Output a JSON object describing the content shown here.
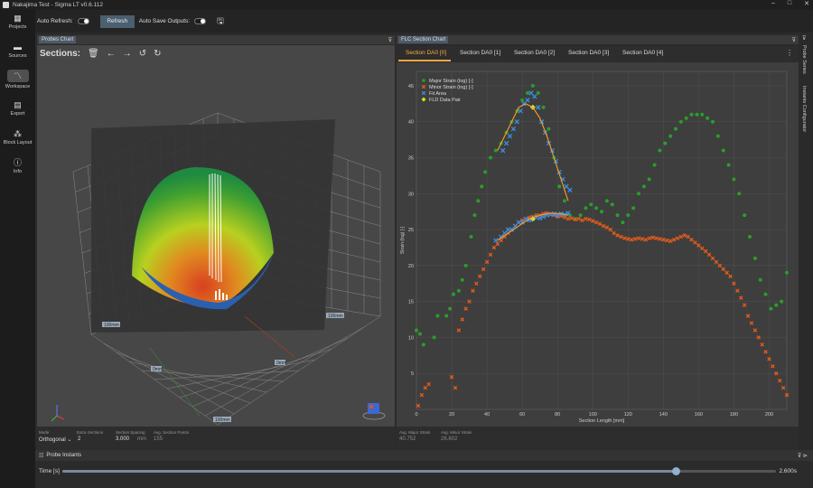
{
  "window": {
    "title": "Nakajima Test - Sigma LT v0.6.112",
    "minimize": "–",
    "maximize": "□",
    "close": "✕"
  },
  "nav": [
    {
      "label": "Projects",
      "icon": "projects-icon"
    },
    {
      "label": "Sources",
      "icon": "folder-icon"
    },
    {
      "label": "Workspace",
      "icon": "workspace-icon"
    },
    {
      "label": "Export",
      "icon": "export-icon"
    },
    {
      "label": "Block Layout",
      "icon": "block-layout-icon"
    },
    {
      "label": "Info",
      "icon": "info-icon"
    }
  ],
  "toolbar": {
    "auto_refresh": "Auto Refresh:",
    "refresh": "Refresh",
    "auto_save": "Auto Save Outputs:"
  },
  "probes_panel": {
    "title": "Probes Chart",
    "sections_label": "Sections:",
    "axis_labels": {
      "a": "100mm",
      "b": "100mm",
      "c": "0mm",
      "d": "0mm",
      "e": "100mm"
    }
  },
  "fields": {
    "mode_label": "Mode",
    "mode_value": "Orthogonal",
    "extra_label": "Extra Sections",
    "extra_value": "2",
    "spacing_label": "Section Spacing",
    "spacing_value": "3.000",
    "spacing_unit": "mm",
    "avgpts_label": "Avg. Section Points",
    "avgpts_value": "155",
    "avgmajor_label": "Avg. Major Strain",
    "avgmajor_value": "40.752",
    "avgminor_label": "Avg. Minor Strain",
    "avgminor_value": "26.602"
  },
  "flc_panel": {
    "title": "FLC Section Chart",
    "tabs": [
      "Section DA0 [0]",
      "Section DA0 [1]",
      "Section DA0 [2]",
      "Section DA0 [3]",
      "Section DA0 [4]"
    ],
    "side_tabs": [
      "Probe Series",
      "Instants Configurator"
    ]
  },
  "instants": {
    "title": "Probe Instants",
    "time_label": "Time [s]",
    "time_value": "2.600s",
    "progress": 0.86
  },
  "colors": {
    "major": "#2a9d2a",
    "minor": "#e65c1a",
    "fit": "#3a8fe8",
    "fld": "#d9e021",
    "curve": "#ffa020"
  },
  "chart_data": {
    "type": "scatter",
    "xlabel": "Section Length [mm]",
    "ylabel": "Strain (log) [-]",
    "xlim": [
      0,
      210
    ],
    "ylim": [
      0,
      47
    ],
    "xticks": [
      0,
      20,
      40,
      60,
      80,
      100,
      120,
      140,
      160,
      180,
      200
    ],
    "yticks": [
      5,
      10,
      15,
      20,
      25,
      30,
      35,
      40,
      45
    ],
    "legend": [
      "Major Strain (log) [-]",
      "Minor Strain (log) [-]",
      "Fit Area",
      "FLD Data Pair"
    ],
    "legend_position": "top-left",
    "series": [
      {
        "name": "Major Strain (log) [-]",
        "marker": "dot",
        "color": "#2a9d2a",
        "x": [
          0,
          2,
          4,
          10,
          12,
          17,
          19,
          21,
          24,
          26,
          28,
          31,
          33,
          35,
          37,
          39,
          42,
          45,
          48,
          51,
          54,
          57,
          60,
          63,
          66,
          69,
          72,
          75,
          78,
          81,
          84,
          87,
          90,
          93,
          96,
          99,
          102,
          105,
          108,
          111,
          114,
          117,
          120,
          123,
          126,
          129,
          132,
          135,
          138,
          141,
          144,
          147,
          150,
          153,
          156,
          159,
          162,
          165,
          168,
          171,
          174,
          177,
          180,
          183,
          186,
          189,
          192,
          195,
          198,
          201,
          204,
          207,
          210
        ],
        "y": [
          11,
          10.5,
          9,
          10,
          13,
          13,
          14,
          16,
          16.5,
          18,
          20,
          24,
          27,
          29,
          31,
          33,
          35,
          36,
          37,
          38.5,
          40,
          41.5,
          43,
          44,
          45,
          44,
          42,
          39,
          35,
          31,
          29,
          27,
          26.5,
          27,
          28,
          28.5,
          28,
          27.5,
          29,
          28.5,
          27,
          26,
          27,
          28,
          30,
          31,
          32,
          34,
          36,
          37,
          38,
          39,
          40,
          40.5,
          41,
          41,
          41,
          40.5,
          40,
          38,
          36,
          34,
          32,
          30,
          27,
          24,
          21,
          18,
          16,
          14,
          14.5,
          15,
          19
        ]
      },
      {
        "name": "Minor Strain (log) [-]",
        "marker": "x",
        "color": "#e65c1a",
        "x": [
          1,
          3,
          5,
          7,
          20,
          22,
          24,
          26,
          28,
          30,
          32,
          34,
          36,
          38,
          40,
          42,
          44,
          46,
          48,
          50,
          52,
          54,
          56,
          58,
          60,
          62,
          64,
          66,
          68,
          70,
          72,
          74,
          76,
          78,
          80,
          82,
          84,
          86,
          88,
          90,
          92,
          94,
          96,
          98,
          100,
          102,
          104,
          106,
          108,
          110,
          112,
          114,
          116,
          118,
          120,
          122,
          124,
          126,
          128,
          130,
          132,
          134,
          136,
          138,
          140,
          142,
          144,
          146,
          148,
          150,
          152,
          154,
          156,
          158,
          160,
          162,
          164,
          166,
          168,
          170,
          172,
          174,
          176,
          178,
          180,
          182,
          184,
          186,
          188,
          190,
          192,
          194,
          196,
          198,
          200,
          202,
          204,
          206,
          208,
          210
        ],
        "y": [
          0.5,
          2,
          3,
          3.5,
          4.5,
          3,
          11,
          12.5,
          14,
          15,
          16.5,
          17.5,
          18.5,
          19.5,
          20.5,
          21.5,
          22.5,
          23,
          23.5,
          24,
          24.5,
          25,
          25.5,
          26,
          26.3,
          26.5,
          26.7,
          26.8,
          27,
          27,
          27.2,
          27.3,
          27.1,
          27,
          26.8,
          26.9,
          26.7,
          26.5,
          26.6,
          26.4,
          26.5,
          26.3,
          26.5,
          26.4,
          26.2,
          26,
          25.8,
          25.5,
          25.3,
          25,
          24.5,
          24.2,
          24,
          23.8,
          23.7,
          23.6,
          23.7,
          23.8,
          23.7,
          23.6,
          23.8,
          23.9,
          23.8,
          23.7,
          23.6,
          23.5,
          23.4,
          23.6,
          23.8,
          24,
          24.2,
          24,
          23.6,
          23.2,
          22.8,
          22.4,
          22,
          21.5,
          21,
          20.5,
          20,
          19.5,
          19,
          18.5,
          17.5,
          16.5,
          15.5,
          14.5,
          13,
          12,
          11,
          10,
          9,
          8,
          7,
          6,
          5,
          4,
          3,
          2
        ]
      },
      {
        "name": "Fit Area",
        "marker": "x",
        "color": "#3a8fe8",
        "x": [
          45,
          48,
          50,
          52,
          54,
          56,
          58,
          60,
          62,
          64,
          66,
          68,
          70,
          72,
          74,
          76,
          78,
          80,
          82,
          84,
          86,
          49,
          51,
          53,
          55,
          57,
          59,
          61,
          63,
          65,
          67,
          69,
          71,
          73,
          75,
          77,
          79,
          81,
          83,
          85,
          87
        ],
        "y": [
          23.5,
          24,
          24.5,
          25,
          25,
          25.5,
          26,
          26,
          26.5,
          26.3,
          26.5,
          26.7,
          26.6,
          26.8,
          27,
          27.1,
          27.2,
          27,
          27.2,
          27.1,
          27.3,
          36,
          37,
          38,
          39,
          40,
          41.5,
          42.5,
          43,
          44,
          43.5,
          42,
          40,
          38.5,
          37,
          36,
          34.5,
          33,
          32,
          31,
          30.5
        ]
      },
      {
        "name": "FLD Data Pair",
        "marker": "diamond",
        "color": "#d9e021",
        "x": [
          66,
          66
        ],
        "y": [
          42,
          26.5
        ]
      }
    ],
    "fit_curves": [
      {
        "color": "#ffa020",
        "x": [
          46,
          50,
          54,
          58,
          62,
          66,
          70,
          74,
          78,
          82,
          86
        ],
        "y": [
          36,
          38,
          40,
          42,
          42.5,
          42,
          40.5,
          38,
          35,
          32,
          29
        ]
      },
      {
        "color": "#ffa020",
        "x": [
          46,
          52,
          58,
          64,
          70,
          76,
          82,
          86
        ],
        "y": [
          23.5,
          24.5,
          25.5,
          26.5,
          27,
          27.3,
          27.2,
          27
        ]
      }
    ]
  }
}
